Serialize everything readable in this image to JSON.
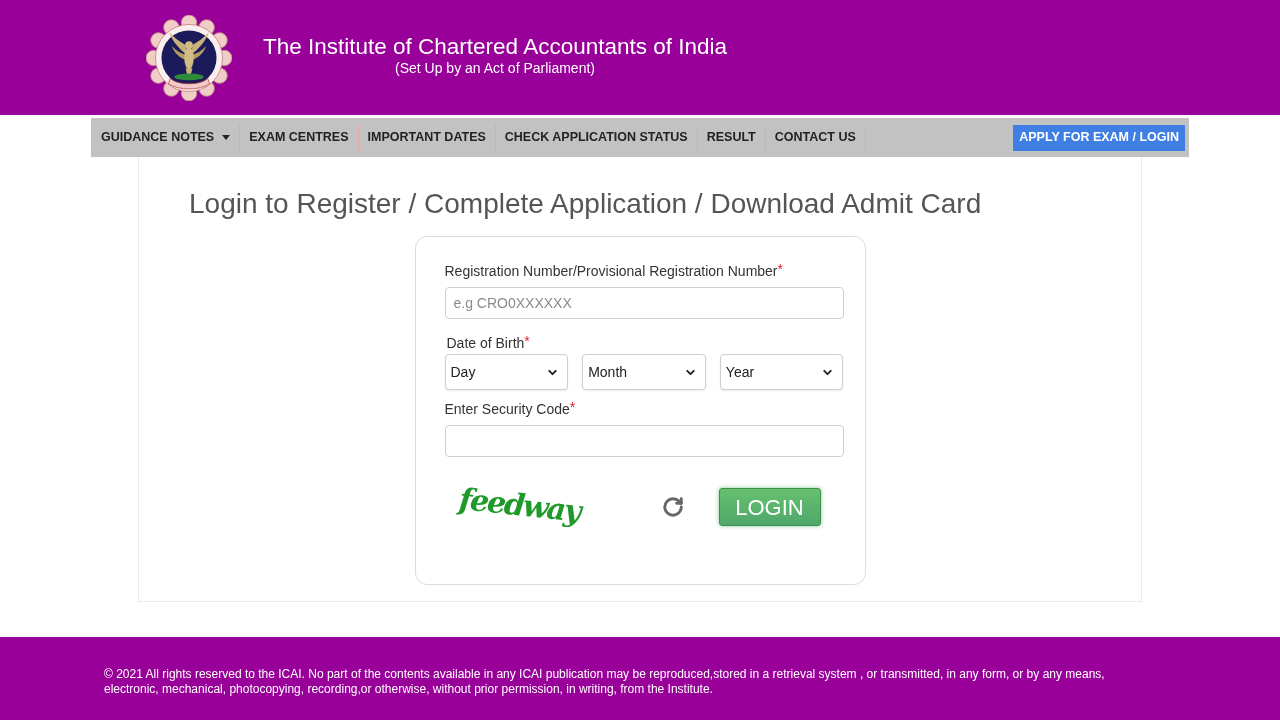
{
  "header": {
    "title": "The Institute of Chartered Accountants of India",
    "subtitle": "(Set Up by an Act of Parliament)"
  },
  "nav": {
    "items": [
      {
        "label": "GUIDANCE NOTES",
        "has_dropdown": true
      },
      {
        "label": "EXAM CENTRES",
        "has_dropdown": false
      },
      {
        "label": "IMPORTANT DATES",
        "has_dropdown": false
      },
      {
        "label": "CHECK APPLICATION STATUS",
        "has_dropdown": false
      },
      {
        "label": "RESULT",
        "has_dropdown": false
      },
      {
        "label": "CONTACT US",
        "has_dropdown": false
      }
    ],
    "action_button": "APPLY FOR EXAM / LOGIN"
  },
  "page_title": "Login to Register / Complete Application / Download Admit Card",
  "login_form": {
    "fields": [
      {
        "kind": "text",
        "label": "Registration Number/Provisional Registration Number",
        "required_mark": "*",
        "placeholder": "e.g CRO0XXXXXX"
      },
      {
        "kind": "date",
        "label": "Date of Birth",
        "required_mark": "*",
        "selects": [
          "Day",
          "Month",
          "Year"
        ]
      },
      {
        "kind": "text",
        "label": "Enter Security Code",
        "required_mark": "*"
      }
    ],
    "captcha": "feedway",
    "submit": "LOGIN"
  },
  "footer": {
    "text": "© 2021 All rights reserved to the ICAI. No part of the contents available in any ICAI publication may be reproduced,stored in a retrieval system , or transmitted, in any form, or by any means, electronic, mechanical, photocopying, recording,or otherwise, without prior permission, in writing, from the Institute."
  }
}
